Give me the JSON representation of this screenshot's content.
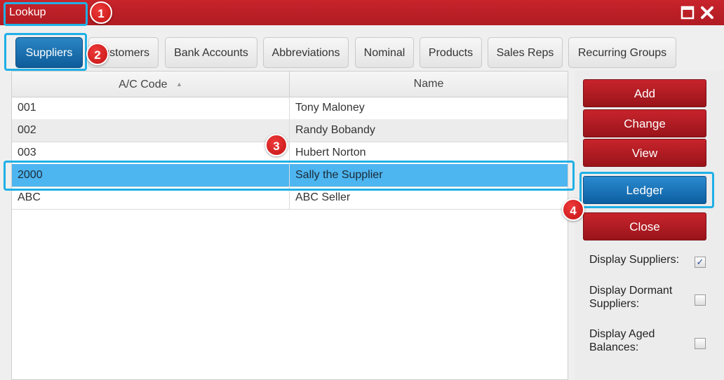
{
  "window": {
    "title": "Lookup"
  },
  "tabs": [
    {
      "label": "Suppliers"
    },
    {
      "label": "Customers"
    },
    {
      "label": "Bank Accounts"
    },
    {
      "label": "Abbreviations"
    },
    {
      "label": "Nominal"
    },
    {
      "label": "Products"
    },
    {
      "label": "Sales Reps"
    },
    {
      "label": "Recurring Groups"
    }
  ],
  "table": {
    "columns": [
      "A/C Code",
      "Name"
    ],
    "rows": [
      {
        "code": "001",
        "name": "Tony Maloney"
      },
      {
        "code": "002",
        "name": "Randy Bobandy"
      },
      {
        "code": "003",
        "name": "Hubert Norton"
      },
      {
        "code": "2000",
        "name": "Sally the Supplier"
      },
      {
        "code": "ABC",
        "name": "ABC Seller"
      }
    ]
  },
  "buttons": {
    "add": "Add",
    "change": "Change",
    "view": "View",
    "ledger": "Ledger",
    "close": "Close"
  },
  "options": {
    "display_suppliers": {
      "label": "Display Suppliers:",
      "checked": true
    },
    "display_dormant": {
      "label_line1": "Display Dormant",
      "label_line2": "Suppliers:",
      "checked": false
    },
    "display_aged": {
      "label_line1": "Display Aged",
      "label_line2": "Balances:",
      "checked": false
    }
  },
  "markers": [
    "1",
    "2",
    "3",
    "4"
  ],
  "colors": {
    "title_bar": "#c8242c",
    "active_tab": "#1a6fae",
    "selected_row": "#4db5f0",
    "highlight": "#1fb0e6",
    "marker": "#d61f1f"
  }
}
